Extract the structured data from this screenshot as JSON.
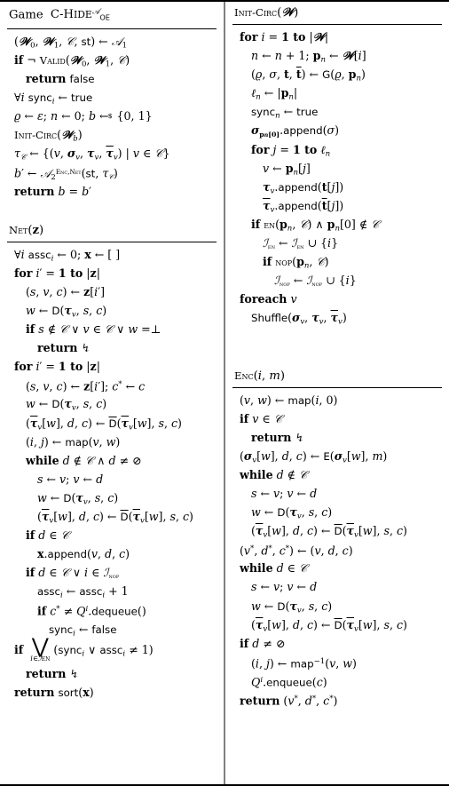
{
  "figure": {
    "columns": [
      {
        "name": "left-column",
        "blocks": [
          {
            "id": "game-c-hide",
            "title": "Game C-HIDE^A_OE",
            "lines": [
              {
                "indent": 0,
                "text": "(W₀, W₁, C, st) ← A₁"
              },
              {
                "indent": 0,
                "text": "if ¬ VALID(W₀, W₁, C)"
              },
              {
                "indent": 1,
                "text": "return false"
              },
              {
                "indent": 0,
                "text": "∀i syncᵢ ← true"
              },
              {
                "indent": 0,
                "text": "ϱ ← ε; n ← 0; b ←$ {0, 1}"
              },
              {
                "indent": 0,
                "text": "INIT-CIRC(W_b)"
              },
              {
                "indent": 0,
                "text": "τ_C ← {(v, σ_v, τ_v, τ̄_v) | v ∈ C}"
              },
              {
                "indent": 0,
                "text": "b′ ← A₂^{ENC,NET}(st, τ_C)"
              },
              {
                "indent": 0,
                "text": "return b = b′"
              }
            ]
          },
          {
            "id": "net",
            "title": "NET(z)",
            "lines": [
              {
                "indent": 0,
                "text": "∀i asscᵢ ← 0; x ← [ ]"
              },
              {
                "indent": 0,
                "text": "for i′ = 1 to |z|"
              },
              {
                "indent": 1,
                "text": "(s, v, c) ← z[i′]"
              },
              {
                "indent": 1,
                "text": "w ← D(τ_v, s, c)"
              },
              {
                "indent": 1,
                "text": "if s ∉ C ∨ v ∈ C ∨ w = ⊥"
              },
              {
                "indent": 2,
                "text": "return ↯"
              },
              {
                "indent": 0,
                "text": "for i′ = 1 to |z|"
              },
              {
                "indent": 1,
                "text": "(s, v, c) ← z[i′]; c* ← c"
              },
              {
                "indent": 1,
                "text": "w ← D(τ_v, s, c)"
              },
              {
                "indent": 1,
                "text": "(τ̄_v[w], d, c) ← D̄(τ̄_v[w], s, c)"
              },
              {
                "indent": 1,
                "text": "(i, j) ← map(v, w)"
              },
              {
                "indent": 1,
                "text": "while d ∉ C ∧ d ≠ ⊘"
              },
              {
                "indent": 2,
                "text": "s ← v; v ← d"
              },
              {
                "indent": 2,
                "text": "w ← D(τ_v, s, c)"
              },
              {
                "indent": 2,
                "text": "(τ̄_v[w], d, c) ← D̄(τ̄_v[w], s, c)"
              },
              {
                "indent": 1,
                "text": "if d ∈ C"
              },
              {
                "indent": 2,
                "text": "x.append(v, d, c)"
              },
              {
                "indent": 1,
                "text": "if d ∈ C ∨ i ∈ I_NOP"
              },
              {
                "indent": 2,
                "text": "asscᵢ ← asscᵢ + 1"
              },
              {
                "indent": 2,
                "text": "if c* ≠ Qⁱ.dequeue()"
              },
              {
                "indent": 3,
                "text": "syncᵢ ← false"
              },
              {
                "indent": 0,
                "text": "if ⋁_{i∈I_EN} (syncᵢ ∨ asscᵢ ≠ 1)"
              },
              {
                "indent": 1,
                "text": "return ↯"
              },
              {
                "indent": 0,
                "text": "return sort(x)"
              }
            ]
          }
        ]
      },
      {
        "name": "right-column",
        "blocks": [
          {
            "id": "init-circ",
            "title": "INIT-CIRC(W)",
            "lines": [
              {
                "indent": 0,
                "text": "for i = 1 to |W|"
              },
              {
                "indent": 1,
                "text": "n ← n + 1; p_n ← W[i]"
              },
              {
                "indent": 1,
                "text": "(ϱ, σ, t, t̄) ← G(ϱ, p_n)"
              },
              {
                "indent": 1,
                "text": "ℓ_n ← |p_n|"
              },
              {
                "indent": 1,
                "text": "sync_n ← true"
              },
              {
                "indent": 1,
                "text": "σ_{p_n[0]}.append(σ)"
              },
              {
                "indent": 1,
                "text": "for j = 1 to ℓ_n"
              },
              {
                "indent": 2,
                "text": "v ← p_n[j]"
              },
              {
                "indent": 2,
                "text": "τ_v.append(t[j])"
              },
              {
                "indent": 2,
                "text": "τ̄_v.append(t̄[j])"
              },
              {
                "indent": 1,
                "text": "if EN(p_n, C) ∧ p_n[0] ∉ C"
              },
              {
                "indent": 2,
                "text": "I_EN ← I_EN ∪ {i}"
              },
              {
                "indent": 2,
                "text": "if NOP(p_n, C)"
              },
              {
                "indent": 3,
                "text": "I_NOP ← I_NOP ∪ {i}"
              },
              {
                "indent": 0,
                "text": "foreach v"
              },
              {
                "indent": 1,
                "text": "Shuffle(σ_v, τ_v, τ̄_v)"
              }
            ]
          },
          {
            "id": "enc",
            "title": "ENC(i, m)",
            "lines": [
              {
                "indent": 0,
                "text": "(v, w) ← map(i, 0)"
              },
              {
                "indent": 0,
                "text": "if v ∈ C"
              },
              {
                "indent": 1,
                "text": "return ↯"
              },
              {
                "indent": 0,
                "text": "(σ_v[w], d, c) ← E(σ_v[w], m)"
              },
              {
                "indent": 0,
                "text": "while d ∉ C"
              },
              {
                "indent": 1,
                "text": "s ← v; v ← d"
              },
              {
                "indent": 1,
                "text": "w ← D(τ_v, s, c)"
              },
              {
                "indent": 1,
                "text": "(τ̄_v[w], d, c) ← D̄(τ̄_v[w], s, c)"
              },
              {
                "indent": 0,
                "text": "(v*, d*, c*) ← (v, d, c)"
              },
              {
                "indent": 0,
                "text": "while d ∈ C"
              },
              {
                "indent": 1,
                "text": "s ← v; v ← d"
              },
              {
                "indent": 1,
                "text": "w ← D(τ_v, s, c)"
              },
              {
                "indent": 1,
                "text": "(τ̄_v[w], d, c) ← D̄(τ̄_v[w], s, c)"
              },
              {
                "indent": 0,
                "text": "if d ≠ ⊘"
              },
              {
                "indent": 1,
                "text": "(i, j) ← map⁻¹(v, w)"
              },
              {
                "indent": 1,
                "text": "Qⁱ.enqueue(c)"
              },
              {
                "indent": 0,
                "text": "return (v*, d*, c*)"
              }
            ]
          }
        ]
      }
    ]
  },
  "titles": {
    "game": {
      "name": "Game",
      "proc": "C-HIDE",
      "sup": "A",
      "sub": "OE"
    },
    "net": {
      "proc": "Net",
      "arg": "(z)"
    },
    "init_circ": {
      "proc": "Init-Circ",
      "arg": "(W)"
    },
    "enc": {
      "proc": "Enc",
      "arg": "(i, m)"
    }
  }
}
